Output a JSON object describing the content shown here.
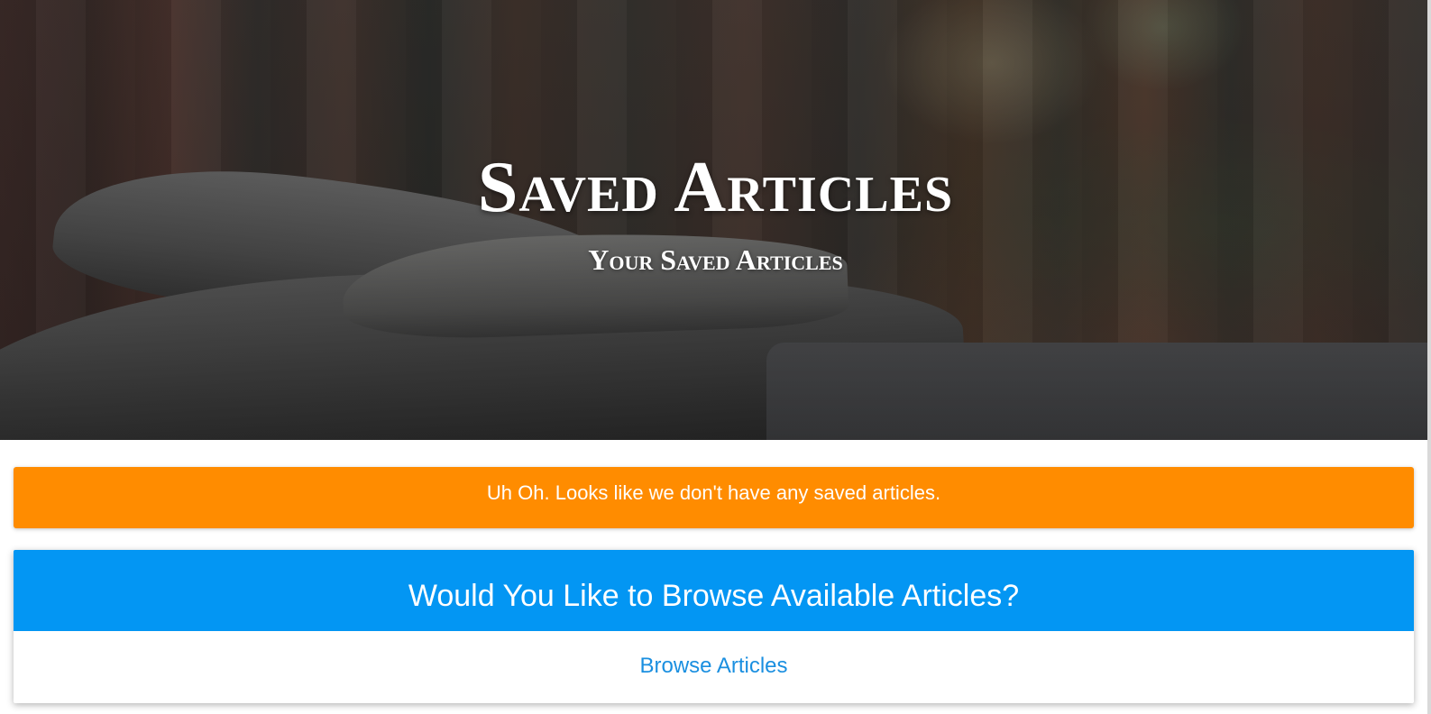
{
  "hero": {
    "title": "Saved Articles",
    "subtitle": "Your Saved Articles"
  },
  "alert": {
    "message": "Uh Oh. Looks like we don't have any saved articles.",
    "color": "#ff8c00"
  },
  "browse": {
    "heading": "Would You Like to Browse Available Articles?",
    "link_label": "Browse Articles",
    "header_color": "#0396f3",
    "link_color": "#1a8fe0"
  }
}
